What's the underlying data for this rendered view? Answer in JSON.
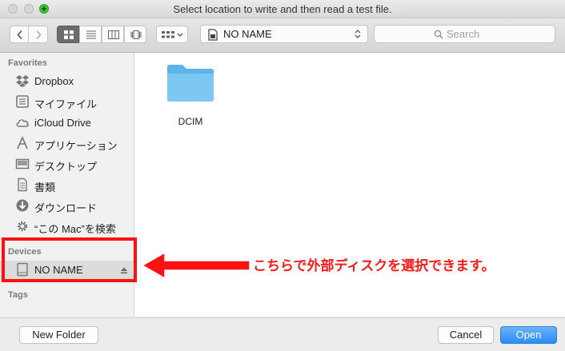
{
  "window": {
    "title": "Select location to write and then read a test file."
  },
  "toolbar": {
    "location_label": "NO NAME",
    "search_placeholder": "Search",
    "view_modes": [
      "icon-view",
      "list-view",
      "column-view",
      "cover-flow-view"
    ],
    "selected_view": "icon-view"
  },
  "sidebar": {
    "favorites_header": "Favorites",
    "favorites": [
      {
        "label": "Dropbox",
        "icon": "dropbox-icon"
      },
      {
        "label": "マイファイル",
        "icon": "all-files-icon"
      },
      {
        "label": "iCloud Drive",
        "icon": "cloud-icon"
      },
      {
        "label": "アプリケーション",
        "icon": "applications-icon"
      },
      {
        "label": "デスクトップ",
        "icon": "desktop-icon"
      },
      {
        "label": "書類",
        "icon": "documents-icon"
      },
      {
        "label": "ダウンロード",
        "icon": "downloads-icon"
      },
      {
        "label": "“この Mac”を検索",
        "icon": "gear-icon"
      }
    ],
    "devices_header": "Devices",
    "devices": [
      {
        "label": "NO NAME",
        "icon": "drive-icon"
      }
    ],
    "tags_header": "Tags"
  },
  "main": {
    "items": [
      {
        "label": "DCIM",
        "icon": "folder-icon"
      }
    ]
  },
  "footer": {
    "new_folder_label": "New Folder",
    "cancel_label": "Cancel",
    "open_label": "Open"
  },
  "annotation": {
    "text": "こちらで外部ディスクを選択できます。",
    "color": "#ff1111"
  }
}
